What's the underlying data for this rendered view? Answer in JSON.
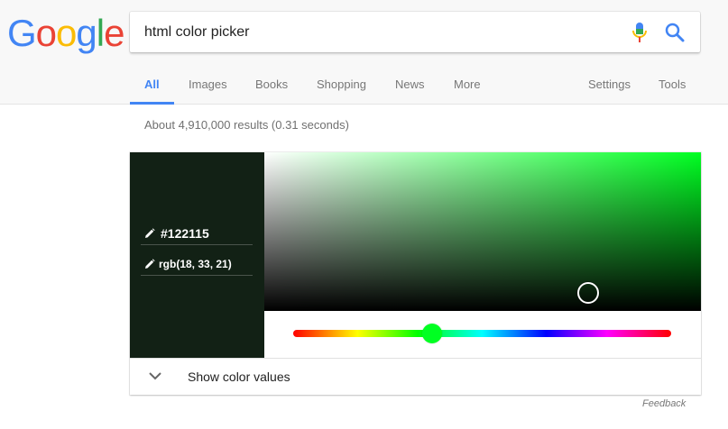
{
  "logo": {
    "text": "Google",
    "colors": [
      "#4285f4",
      "#ea4335",
      "#fbbc05",
      "#4285f4",
      "#34a853",
      "#ea4335"
    ]
  },
  "search": {
    "query": "html color picker"
  },
  "icons": {
    "mic": "mic-icon",
    "search": "search-icon",
    "pencil": "pencil-icon",
    "chevron": "chevron-down-icon"
  },
  "nav": {
    "tabs": [
      {
        "label": "All",
        "active": true
      },
      {
        "label": "Images"
      },
      {
        "label": "Books"
      },
      {
        "label": "Shopping"
      },
      {
        "label": "News"
      },
      {
        "label": "More"
      }
    ],
    "settings": "Settings",
    "tools": "Tools"
  },
  "results": {
    "stats": "About 4,910,000 results (0.31 seconds)"
  },
  "picker": {
    "hex": "#122115",
    "rgb": "rgb(18, 33, 21)",
    "hue_color": "#00ff22",
    "accent": "#4285f4",
    "show_values_label": "Show color values"
  },
  "footer": {
    "feedback": "Feedback"
  }
}
